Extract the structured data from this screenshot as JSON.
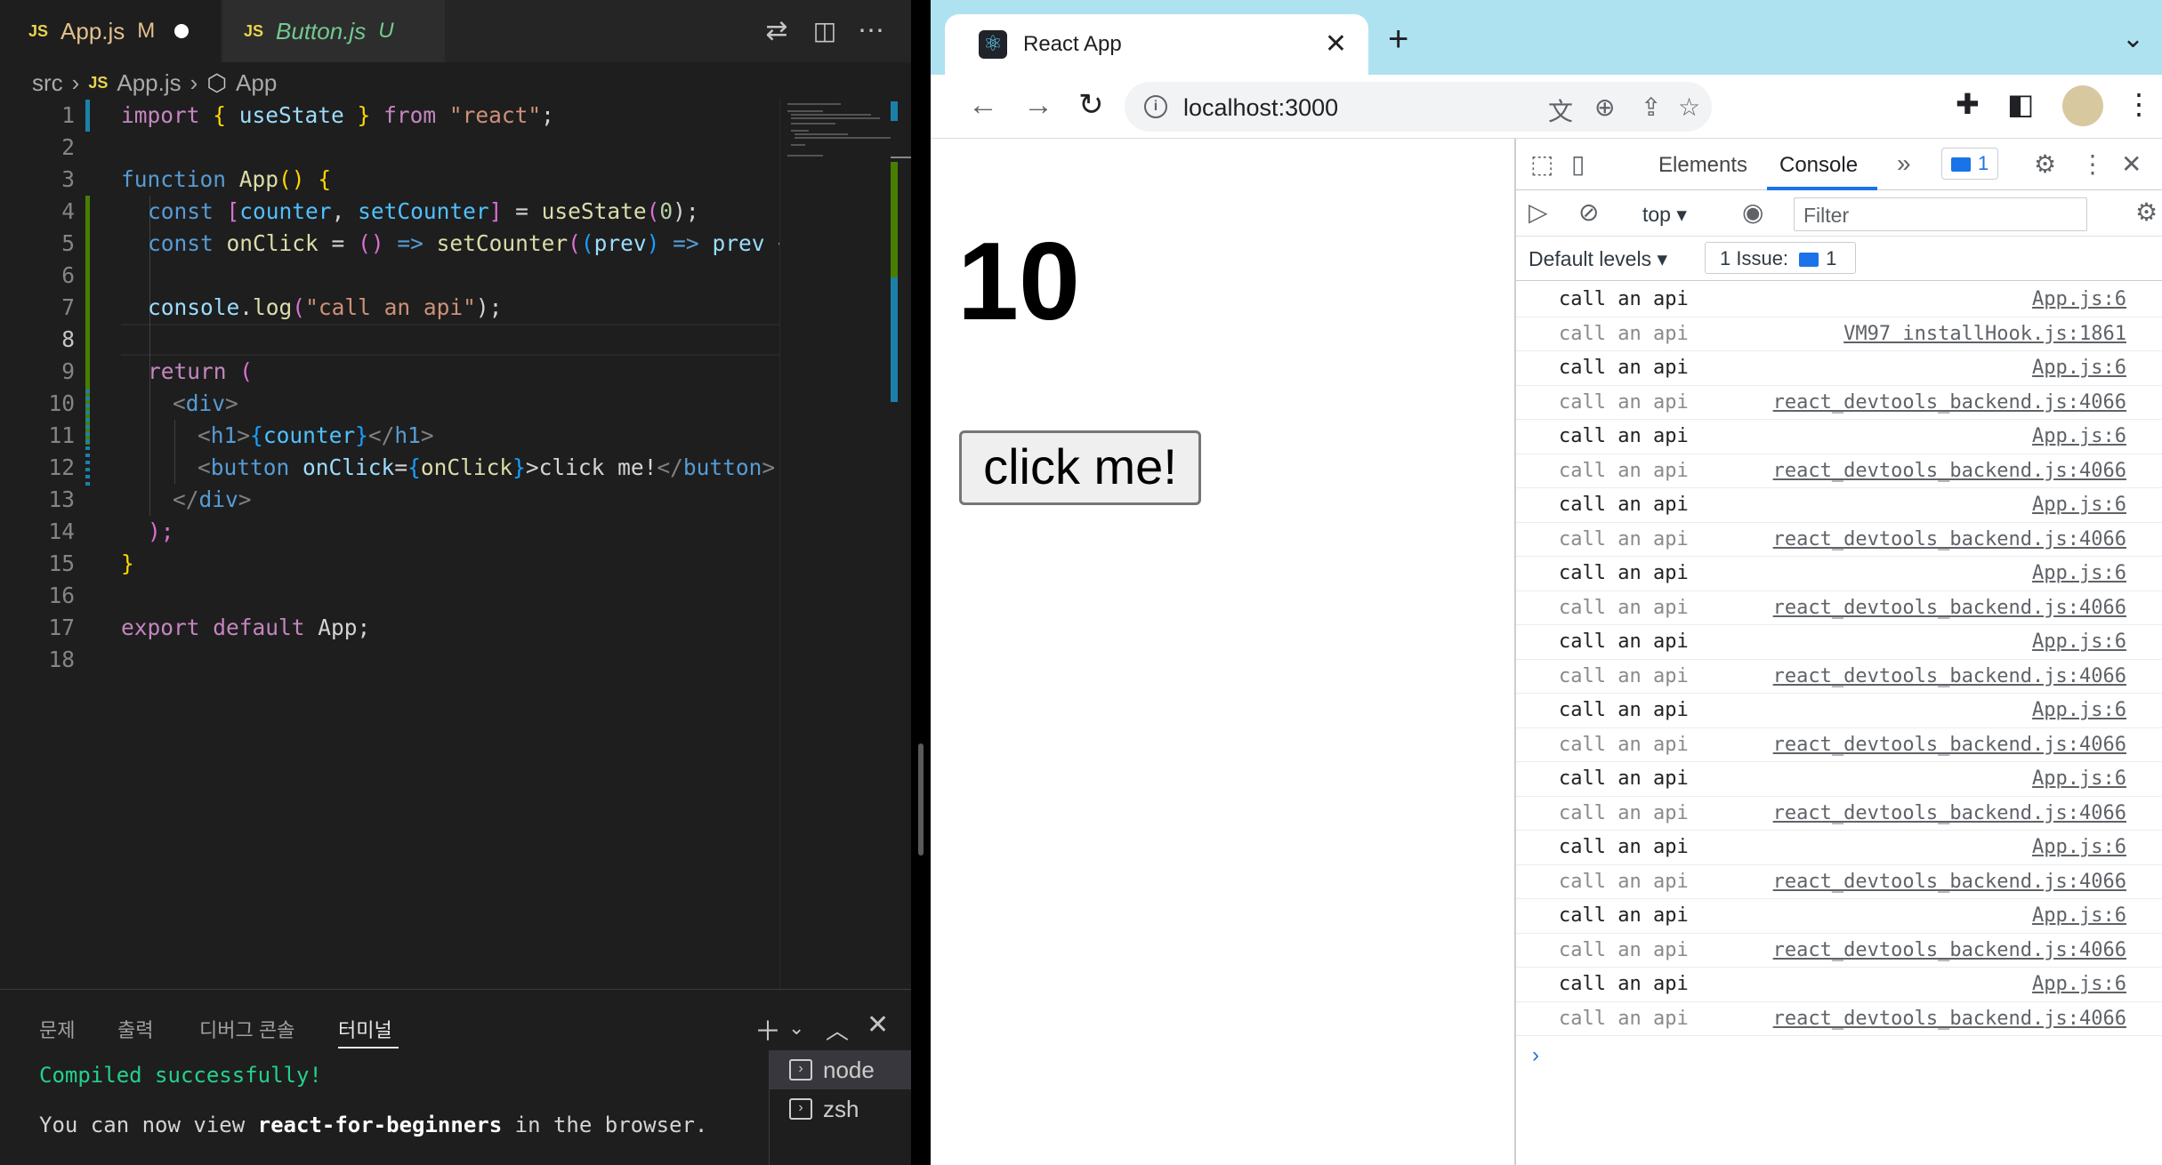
{
  "vscode": {
    "tabs": [
      {
        "icon": "JS",
        "name": "App.js",
        "status": "M"
      },
      {
        "icon": "JS",
        "name": "Button.js",
        "status": "U"
      }
    ],
    "breadcrumb": {
      "folder": "src",
      "file_icon": "JS",
      "file": "App.js",
      "symbol": "App"
    },
    "line_numbers": [
      "1",
      "2",
      "3",
      "4",
      "5",
      "6",
      "7",
      "8",
      "9",
      "10",
      "11",
      "12",
      "13",
      "14",
      "15",
      "16",
      "17",
      "18"
    ],
    "code": {
      "l1": {
        "a": "import",
        "b": " { ",
        "c": "useState",
        "d": " } ",
        "e": "from",
        "f": " ",
        "g": "\"react\"",
        "h": ";"
      },
      "l3": {
        "a": "function",
        "b": " ",
        "c": "App",
        "d": "() ",
        "e": "{"
      },
      "l4": {
        "a": "const",
        "b": " ",
        "c": "[",
        "d": "counter",
        "e": ", ",
        "f": "setCounter",
        "g": "]",
        "h": " = ",
        "i": "useState",
        "j": "(",
        "k": "0",
        "l": ");"
      },
      "l5": {
        "a": "const",
        "b": " ",
        "c": "onClick",
        "d": " = ",
        "e": "()",
        "f": " => ",
        "g": "setCounter",
        "h": "(",
        "i": "(",
        "j": "prev",
        "k": ")",
        "l": " => ",
        "m": "prev +"
      },
      "l7": {
        "a": "console",
        "b": ".",
        "c": "log",
        "d": "(",
        "e": "\"call an api\"",
        "f": ");"
      },
      "l9": {
        "a": "return",
        "b": " ("
      },
      "l10": {
        "a": "<",
        "b": "div",
        "c": ">"
      },
      "l11": {
        "a": "<",
        "b": "h1",
        "c": ">",
        "d": "{",
        "e": "counter",
        "f": "}",
        "g": "</",
        "h": "h1",
        "i": ">"
      },
      "l12": {
        "a": "<",
        "b": "button",
        "c": " ",
        "d": "onClick",
        "e": "=",
        "f": "{",
        "g": "onClick",
        "h": "}",
        "i": ">click me!",
        "j": "</",
        "k": "button",
        "l": ">"
      },
      "l13": {
        "a": "</",
        "b": "div",
        "c": ">"
      },
      "l14": {
        "a": ");"
      },
      "l15": {
        "a": "}"
      },
      "l17": {
        "a": "export",
        "b": " ",
        "c": "default",
        "d": " App;"
      }
    },
    "panel": {
      "tabs": [
        "문제",
        "출력",
        "디버그 콘솔",
        "터미널"
      ],
      "terminal_lines": {
        "compiled": "Compiled successfully!",
        "view_pre": "You can now view ",
        "view_app": "react-for-beginners",
        "view_post": " in the browser."
      },
      "terminals": [
        "node",
        "zsh"
      ]
    }
  },
  "chrome": {
    "tab_title": "React App",
    "url": "localhost:3000",
    "page": {
      "counter": "10",
      "button_label": "click me!"
    },
    "devtools": {
      "tabs": [
        "Elements",
        "Console"
      ],
      "msg_badge": "1",
      "context": "top",
      "filter_placeholder": "Filter",
      "levels": "Default levels",
      "issues": "1 Issue:",
      "issues_count": "1",
      "logs": [
        {
          "msg": "call an api",
          "src": "App.js:6",
          "dim": false
        },
        {
          "msg": "call an api",
          "src": "VM97 installHook.js:1861",
          "dim": true
        },
        {
          "msg": "call an api",
          "src": "App.js:6",
          "dim": false
        },
        {
          "msg": "call an api",
          "src": "react_devtools_backend.js:4066",
          "dim": true
        },
        {
          "msg": "call an api",
          "src": "App.js:6",
          "dim": false
        },
        {
          "msg": "call an api",
          "src": "react_devtools_backend.js:4066",
          "dim": true
        },
        {
          "msg": "call an api",
          "src": "App.js:6",
          "dim": false
        },
        {
          "msg": "call an api",
          "src": "react_devtools_backend.js:4066",
          "dim": true
        },
        {
          "msg": "call an api",
          "src": "App.js:6",
          "dim": false
        },
        {
          "msg": "call an api",
          "src": "react_devtools_backend.js:4066",
          "dim": true
        },
        {
          "msg": "call an api",
          "src": "App.js:6",
          "dim": false
        },
        {
          "msg": "call an api",
          "src": "react_devtools_backend.js:4066",
          "dim": true
        },
        {
          "msg": "call an api",
          "src": "App.js:6",
          "dim": false
        },
        {
          "msg": "call an api",
          "src": "react_devtools_backend.js:4066",
          "dim": true
        },
        {
          "msg": "call an api",
          "src": "App.js:6",
          "dim": false
        },
        {
          "msg": "call an api",
          "src": "react_devtools_backend.js:4066",
          "dim": true
        },
        {
          "msg": "call an api",
          "src": "App.js:6",
          "dim": false
        },
        {
          "msg": "call an api",
          "src": "react_devtools_backend.js:4066",
          "dim": true
        },
        {
          "msg": "call an api",
          "src": "App.js:6",
          "dim": false
        },
        {
          "msg": "call an api",
          "src": "react_devtools_backend.js:4066",
          "dim": true
        },
        {
          "msg": "call an api",
          "src": "App.js:6",
          "dim": false
        },
        {
          "msg": "call an api",
          "src": "react_devtools_backend.js:4066",
          "dim": true
        }
      ]
    }
  }
}
